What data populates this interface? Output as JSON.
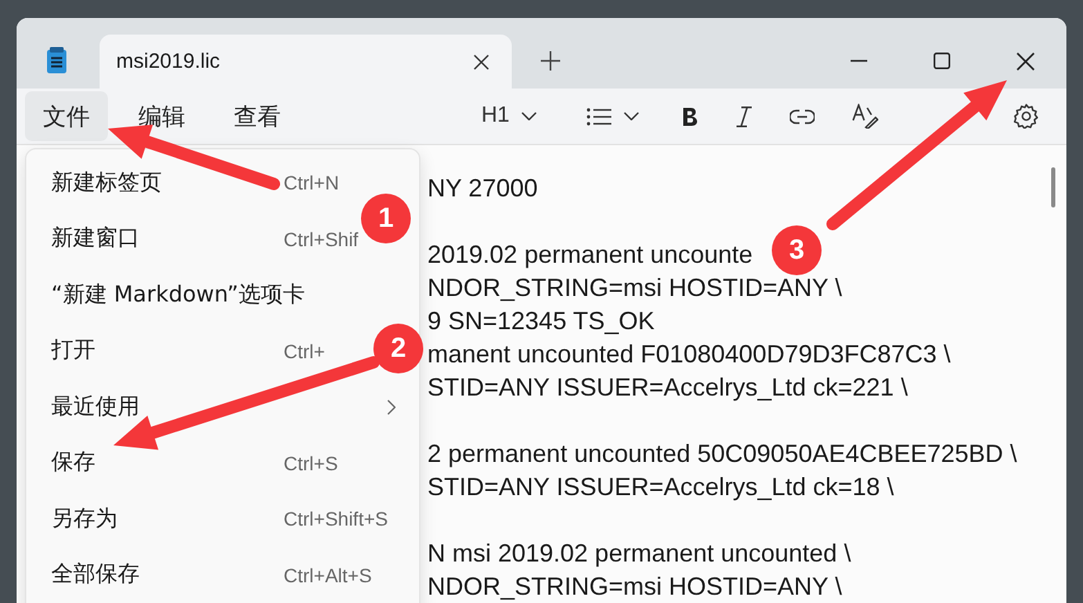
{
  "window": {
    "tab": {
      "title": "msi2019.lic",
      "selected": true
    }
  },
  "menubar": [
    {
      "label": "文件",
      "selected": true
    },
    {
      "label": "编辑",
      "selected": false
    },
    {
      "label": "查看",
      "selected": false
    }
  ],
  "toolbar": {
    "heading": "H1"
  },
  "file_menu": [
    {
      "label": "新建标签页",
      "shortcut": "Ctrl+N",
      "submenu": false
    },
    {
      "label": "新建窗口",
      "shortcut": "Ctrl+Shif",
      "submenu": false
    },
    {
      "label": "“新建 Markdown”选项卡",
      "submenu": false
    },
    {
      "label": "打开",
      "shortcut": "Ctrl+",
      "submenu": false
    },
    {
      "label": "最近使用",
      "submenu": true
    },
    {
      "label": "保存",
      "shortcut": "Ctrl+S",
      "submenu": false
    },
    {
      "label": "另存为",
      "shortcut": "Ctrl+Shift+S",
      "submenu": false
    },
    {
      "label": "全部保存",
      "shortcut": "Ctrl+Alt+S",
      "submenu": false
    }
  ],
  "document_paragraphs": [
    [
      "NY 27000"
    ],
    [
      "2019.02 permanent uncounte",
      "NDOR_STRING=msi HOSTID=ANY \\",
      "9 SN=12345 TS_OK",
      "manent uncounted F01080400D79D3FC87C3 \\",
      "STID=ANY ISSUER=Accelrys_Ltd ck=221 \\"
    ],
    [
      "2 permanent uncounted 50C09050AE4CBEE725BD \\",
      "STID=ANY ISSUER=Accelrys_Ltd ck=18 \\"
    ],
    [
      "N msi 2019.02 permanent uncounted \\",
      "NDOR_STRING=msi HOSTID=ANY \\"
    ]
  ],
  "annotations": [
    {
      "number": "1"
    },
    {
      "number": "2"
    },
    {
      "number": "3"
    }
  ]
}
